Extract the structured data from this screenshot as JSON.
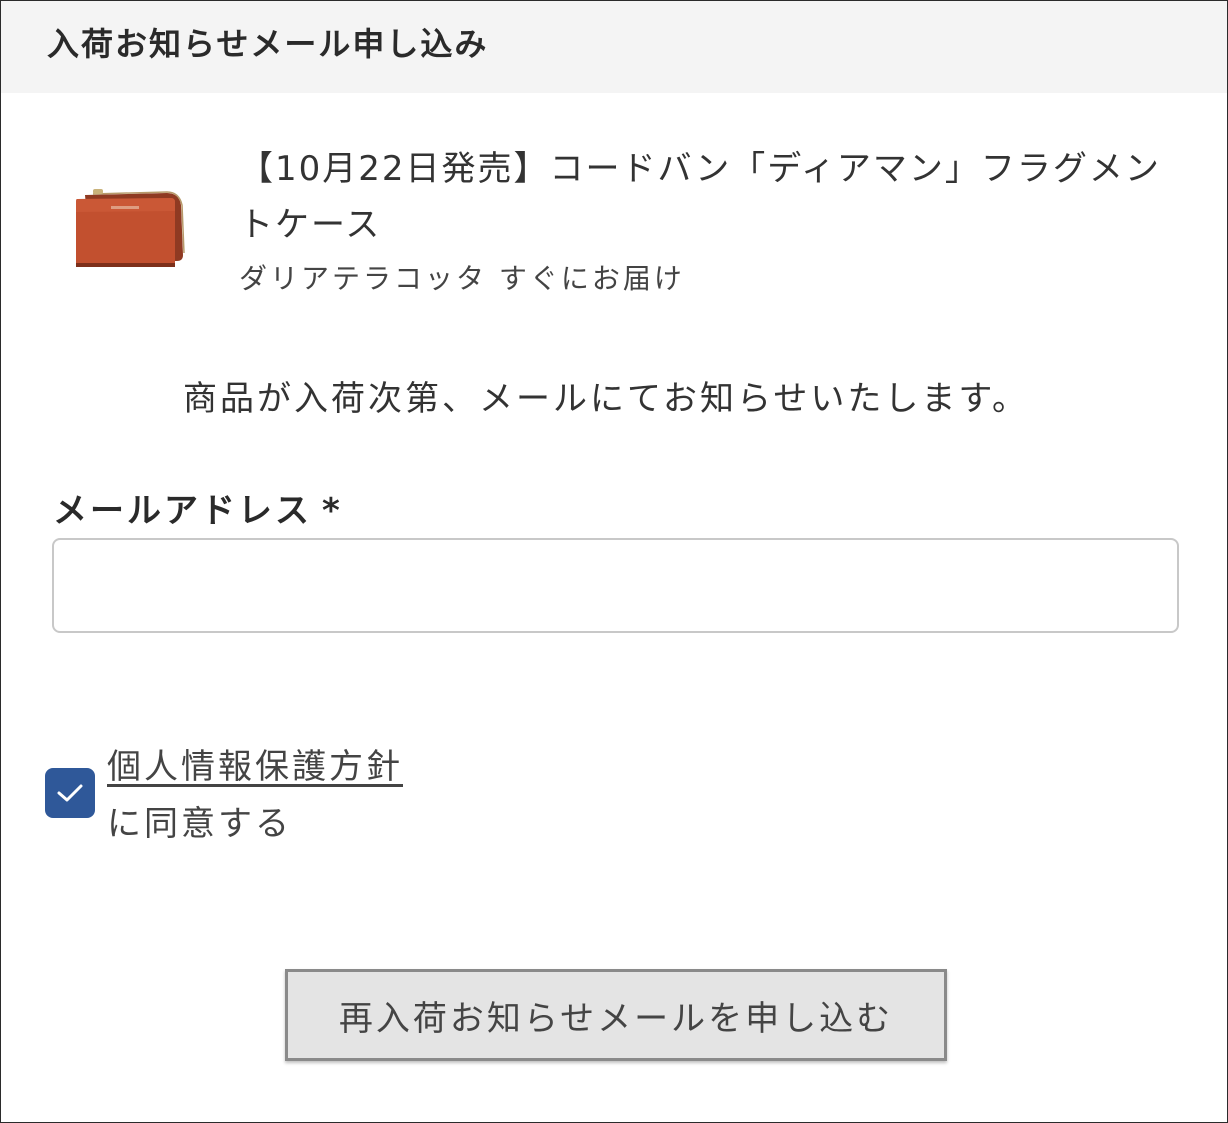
{
  "modal": {
    "title": "入荷お知らせメール申し込み"
  },
  "product": {
    "name": "【10月22日発売】コードバン「ディアマン」フラグメントケース",
    "variant": "ダリアテラコッタ すぐにお届け",
    "thumbnail_icon": "wallet-product-image",
    "thumbnail_color": "#c2502f"
  },
  "notice": {
    "text": "商品が入荷次第、メールにてお知らせいたします。"
  },
  "email": {
    "label": "メールアドレス",
    "required_mark": "*",
    "value": "",
    "placeholder": ""
  },
  "consent": {
    "checked": true,
    "link_text": "個人情報保護方針",
    "suffix_text": "に同意する",
    "checkbox_color": "#2f5899"
  },
  "submit": {
    "label": "再入荷お知らせメールを申し込む"
  }
}
